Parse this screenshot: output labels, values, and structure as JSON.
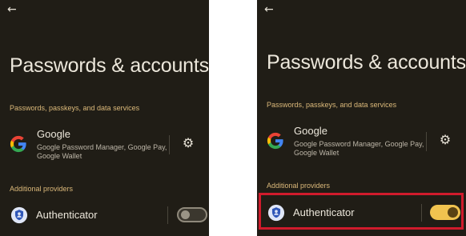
{
  "screens": [
    {
      "id": "before",
      "title": "Passwords & accounts",
      "section_services": "Passwords, passkeys, and data services",
      "provider": {
        "name": "Google",
        "subtitle": "Google Password Manager, Google Pay, Google Wallet",
        "icon": "google-logo-icon"
      },
      "section_additional": "Additional providers",
      "additional_provider": {
        "name": "Authenticator",
        "icon": "authenticator-icon",
        "enabled": false
      },
      "highlighted": false
    },
    {
      "id": "after",
      "title": "Passwords & accounts",
      "section_services": "Passwords, passkeys, and data services",
      "provider": {
        "name": "Google",
        "subtitle": "Google Password Manager, Google Pay, Google Wallet",
        "icon": "google-logo-icon"
      },
      "section_additional": "Additional providers",
      "additional_provider": {
        "name": "Authenticator",
        "icon": "authenticator-icon",
        "enabled": true
      },
      "highlighted": true,
      "highlight_color": "#d01b2c"
    }
  ],
  "colors": {
    "background": "#201d16",
    "accent": "#f1c34f",
    "section_label": "#dbb97a"
  }
}
